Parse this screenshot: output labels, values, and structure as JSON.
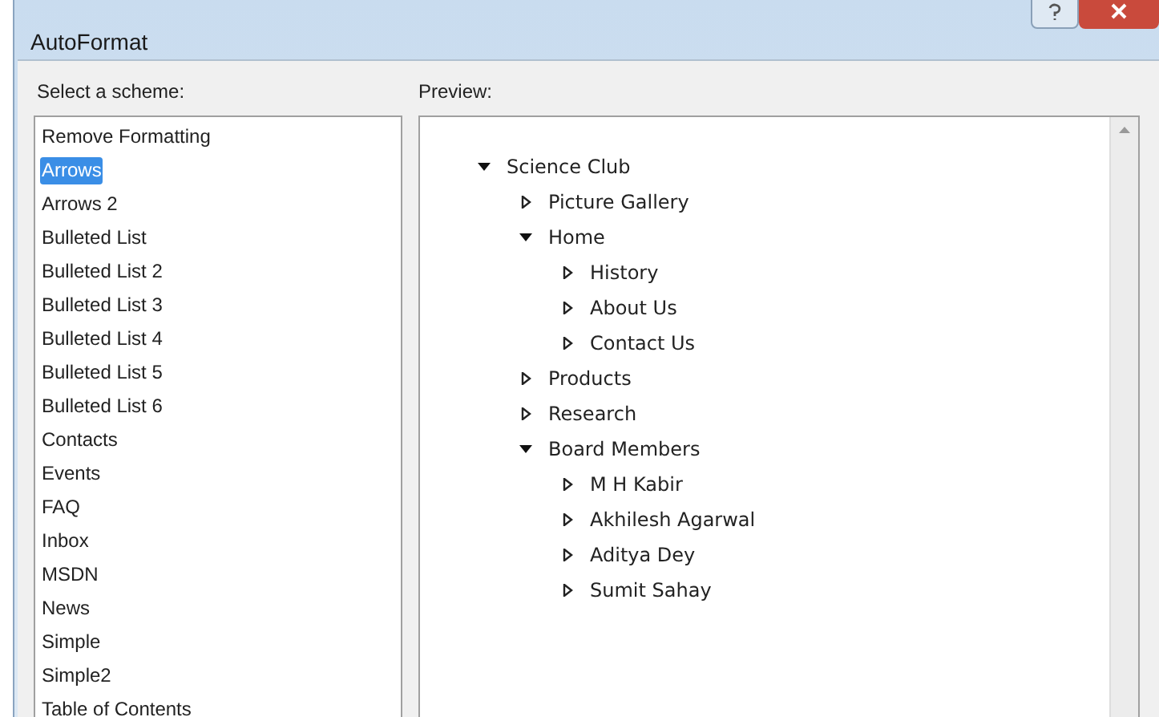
{
  "window": {
    "title": "AutoFormat"
  },
  "scheme_list": {
    "label": "Select a scheme:",
    "items": [
      {
        "label": "Remove Formatting",
        "selected": false
      },
      {
        "label": "Arrows",
        "selected": true
      },
      {
        "label": "Arrows 2",
        "selected": false
      },
      {
        "label": "Bulleted List",
        "selected": false
      },
      {
        "label": "Bulleted List 2",
        "selected": false
      },
      {
        "label": "Bulleted List 3",
        "selected": false
      },
      {
        "label": "Bulleted List 4",
        "selected": false
      },
      {
        "label": "Bulleted List 5",
        "selected": false
      },
      {
        "label": "Bulleted List 6",
        "selected": false
      },
      {
        "label": "Contacts",
        "selected": false
      },
      {
        "label": "Events",
        "selected": false
      },
      {
        "label": "FAQ",
        "selected": false
      },
      {
        "label": "Inbox",
        "selected": false
      },
      {
        "label": "MSDN",
        "selected": false
      },
      {
        "label": "News",
        "selected": false
      },
      {
        "label": "Simple",
        "selected": false
      },
      {
        "label": "Simple2",
        "selected": false
      },
      {
        "label": "Table of Contents",
        "selected": false
      }
    ]
  },
  "preview": {
    "label": "Preview:",
    "tree": [
      {
        "label": "Science Club",
        "expanded": true,
        "children": [
          {
            "label": "Picture Gallery",
            "expanded": false
          },
          {
            "label": "Home",
            "expanded": true,
            "children": [
              {
                "label": "History",
                "expanded": false
              },
              {
                "label": "About Us",
                "expanded": false
              },
              {
                "label": "Contact Us",
                "expanded": false
              }
            ]
          },
          {
            "label": "Products",
            "expanded": false
          },
          {
            "label": "Research",
            "expanded": false
          },
          {
            "label": "Board Members",
            "expanded": true,
            "children": [
              {
                "label": "M H Kabir",
                "expanded": false
              },
              {
                "label": "Akhilesh Agarwal",
                "expanded": false
              },
              {
                "label": "Aditya Dey",
                "expanded": false
              },
              {
                "label": "Sumit Sahay",
                "expanded": false
              }
            ]
          }
        ]
      }
    ]
  }
}
